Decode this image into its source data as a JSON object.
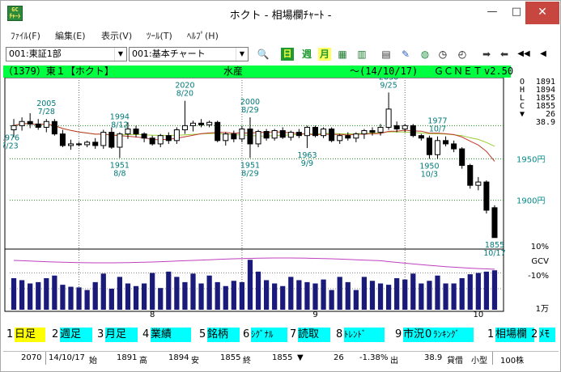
{
  "window": {
    "title": "ホクト - 相場欄ﾁｬｰﾄ -",
    "app_icon_text": "GC\nmaan",
    "min_glyph": "—",
    "max_glyph": "□",
    "close_glyph": "✕"
  },
  "menu": [
    {
      "label": "ﾌｧｲﾙ(F)"
    },
    {
      "label": "編集(E)"
    },
    {
      "label": "表示(V)"
    },
    {
      "label": "ﾂｰﾙ(T)"
    },
    {
      "label": "ﾍﾙﾌﾟ(H)"
    }
  ],
  "toolbar": {
    "market_select": "001:東証1部",
    "chart_select": "001:基本チャート",
    "day_label": "日",
    "week_label": "週",
    "month_label": "月"
  },
  "info": {
    "code": "（1379）東１【ホクト】",
    "sector": "水産",
    "date": "〜(14/10/17)",
    "brand": "ＧＣＮＥＴ",
    "version": "v2.50"
  },
  "ohlc": [
    {
      "key": "O",
      "value": "1891"
    },
    {
      "key": "H",
      "value": "1894"
    },
    {
      "key": "L",
      "value": "1855"
    },
    {
      "key": "C",
      "value": "1855"
    },
    {
      "key": "▼",
      "value": "26"
    },
    {
      "key": "",
      "value": "38.9"
    }
  ],
  "chart_data": {
    "type": "candlestick",
    "price_axis_labels": [
      "1950円",
      "1900円"
    ],
    "price_range": [
      1845,
      2045
    ],
    "volume_axis_labels": [
      "10%",
      "GCV",
      "-10%",
      "1万"
    ],
    "x_ticks": [
      "8",
      "9",
      "10"
    ],
    "annotations": [
      {
        "date": "7/28",
        "value": "2005"
      },
      {
        "date": "8/12",
        "value": "1994"
      },
      {
        "date": "8/20",
        "value": "2020"
      },
      {
        "date": "8/29",
        "value": "2000"
      },
      {
        "date": "9/25",
        "value": "2030"
      },
      {
        "date": "10/7",
        "value": "1977"
      },
      {
        "date": "7/23",
        "value": "1976"
      },
      {
        "date": "8/8",
        "value": "1951"
      },
      {
        "date": "8/29",
        "value": "1951"
      },
      {
        "date": "9/9",
        "value": "1963"
      },
      {
        "date": "10/3",
        "value": "1950"
      },
      {
        "date": "10/17",
        "value": "1855"
      }
    ],
    "candles": [
      {
        "o": 1985,
        "h": 1998,
        "l": 1976,
        "c": 1990
      },
      {
        "o": 1990,
        "h": 2000,
        "l": 1984,
        "c": 1995
      },
      {
        "o": 1995,
        "h": 2005,
        "l": 1987,
        "c": 1992
      },
      {
        "o": 1992,
        "h": 1998,
        "l": 1985,
        "c": 1988
      },
      {
        "o": 1988,
        "h": 1998,
        "l": 1982,
        "c": 1995
      },
      {
        "o": 1995,
        "h": 1998,
        "l": 1978,
        "c": 1980
      },
      {
        "o": 1980,
        "h": 1985,
        "l": 1964,
        "c": 1966
      },
      {
        "o": 1966,
        "h": 1973,
        "l": 1961,
        "c": 1968
      },
      {
        "o": 1968,
        "h": 1970,
        "l": 1965,
        "c": 1967
      },
      {
        "o": 1967,
        "h": 1972,
        "l": 1964,
        "c": 1970
      },
      {
        "o": 1970,
        "h": 1975,
        "l": 1962,
        "c": 1966
      },
      {
        "o": 1966,
        "h": 1985,
        "l": 1962,
        "c": 1982
      },
      {
        "o": 1982,
        "h": 1988,
        "l": 1962,
        "c": 1964
      },
      {
        "o": 1964,
        "h": 1982,
        "l": 1951,
        "c": 1980
      },
      {
        "o": 1980,
        "h": 1994,
        "l": 1974,
        "c": 1986
      },
      {
        "o": 1986,
        "h": 1990,
        "l": 1976,
        "c": 1980
      },
      {
        "o": 1980,
        "h": 1982,
        "l": 1970,
        "c": 1975
      },
      {
        "o": 1975,
        "h": 1978,
        "l": 1966,
        "c": 1968
      },
      {
        "o": 1968,
        "h": 1980,
        "l": 1964,
        "c": 1978
      },
      {
        "o": 1978,
        "h": 1982,
        "l": 1968,
        "c": 1972
      },
      {
        "o": 1972,
        "h": 1988,
        "l": 1968,
        "c": 1985
      },
      {
        "o": 1985,
        "h": 2020,
        "l": 1980,
        "c": 1990
      },
      {
        "o": 1990,
        "h": 1996,
        "l": 1983,
        "c": 1993
      },
      {
        "o": 1993,
        "h": 1998,
        "l": 1988,
        "c": 1991
      },
      {
        "o": 1991,
        "h": 1996,
        "l": 1988,
        "c": 1994
      },
      {
        "o": 1994,
        "h": 1996,
        "l": 1970,
        "c": 1972
      },
      {
        "o": 1972,
        "h": 1982,
        "l": 1966,
        "c": 1980
      },
      {
        "o": 1980,
        "h": 1984,
        "l": 1970,
        "c": 1974
      },
      {
        "o": 1974,
        "h": 1990,
        "l": 1970,
        "c": 1986
      },
      {
        "o": 1986,
        "h": 2000,
        "l": 1951,
        "c": 1968
      },
      {
        "o": 1968,
        "h": 1985,
        "l": 1964,
        "c": 1983
      },
      {
        "o": 1983,
        "h": 1986,
        "l": 1972,
        "c": 1975
      },
      {
        "o": 1975,
        "h": 1986,
        "l": 1972,
        "c": 1984
      },
      {
        "o": 1984,
        "h": 1988,
        "l": 1974,
        "c": 1976
      },
      {
        "o": 1976,
        "h": 1984,
        "l": 1972,
        "c": 1982
      },
      {
        "o": 1982,
        "h": 1986,
        "l": 1975,
        "c": 1978
      },
      {
        "o": 1978,
        "h": 1990,
        "l": 1963,
        "c": 1988
      },
      {
        "o": 1988,
        "h": 1990,
        "l": 1976,
        "c": 1978
      },
      {
        "o": 1978,
        "h": 1988,
        "l": 1975,
        "c": 1986
      },
      {
        "o": 1986,
        "h": 1988,
        "l": 1970,
        "c": 1972
      },
      {
        "o": 1972,
        "h": 1980,
        "l": 1968,
        "c": 1978
      },
      {
        "o": 1978,
        "h": 1982,
        "l": 1972,
        "c": 1975
      },
      {
        "o": 1975,
        "h": 1982,
        "l": 1970,
        "c": 1980
      },
      {
        "o": 1980,
        "h": 1986,
        "l": 1974,
        "c": 1984
      },
      {
        "o": 1984,
        "h": 1988,
        "l": 1978,
        "c": 1982
      },
      {
        "o": 1982,
        "h": 1992,
        "l": 1978,
        "c": 1988
      },
      {
        "o": 1988,
        "h": 2030,
        "l": 1985,
        "c": 2010
      },
      {
        "o": 1990,
        "h": 1995,
        "l": 1982,
        "c": 1986
      },
      {
        "o": 1986,
        "h": 1992,
        "l": 1982,
        "c": 1990
      },
      {
        "o": 1990,
        "h": 1992,
        "l": 1976,
        "c": 1978
      },
      {
        "o": 1978,
        "h": 1980,
        "l": 1972,
        "c": 1975
      },
      {
        "o": 1975,
        "h": 1978,
        "l": 1950,
        "c": 1955
      },
      {
        "o": 1955,
        "h": 1977,
        "l": 1950,
        "c": 1972
      },
      {
        "o": 1972,
        "h": 1977,
        "l": 1965,
        "c": 1968
      },
      {
        "o": 1968,
        "h": 1972,
        "l": 1958,
        "c": 1962
      },
      {
        "o": 1962,
        "h": 1964,
        "l": 1938,
        "c": 1942
      },
      {
        "o": 1942,
        "h": 1944,
        "l": 1914,
        "c": 1918
      },
      {
        "o": 1918,
        "h": 1928,
        "l": 1912,
        "c": 1922
      },
      {
        "o": 1922,
        "h": 1924,
        "l": 1884,
        "c": 1888
      },
      {
        "o": 1891,
        "h": 1894,
        "l": 1855,
        "c": 1855
      }
    ],
    "volume": [
      48,
      45,
      40,
      42,
      48,
      52,
      38,
      35,
      34,
      30,
      42,
      55,
      32,
      50,
      40,
      36,
      40,
      56,
      33,
      58,
      50,
      42,
      55,
      40,
      52,
      42,
      36,
      44,
      42,
      76,
      58,
      45,
      40,
      36,
      50,
      45,
      42,
      40,
      46,
      30,
      50,
      42,
      30,
      50,
      44,
      40,
      38,
      48,
      46,
      55,
      40,
      44,
      52,
      40,
      40,
      48,
      54,
      56,
      58,
      60
    ],
    "volume_range": [
      0,
      80
    ],
    "grid": true
  },
  "tabs": [
    {
      "num": "1",
      "label": "日足",
      "bg": "#ffff00"
    },
    {
      "num": "2",
      "label": "週足",
      "bg": "#00ffff"
    },
    {
      "num": "3",
      "label": "月足",
      "bg": "#00ffff"
    },
    {
      "num": "4",
      "label": "業績",
      "bg": "#00ffff"
    },
    {
      "num": "5",
      "label": "銘柄",
      "bg": "#00ffff"
    },
    {
      "num": "6",
      "label": "ｼｸﾞﾅﾙ",
      "bg": "#00ffff"
    },
    {
      "num": "7",
      "label": "読取",
      "bg": "#00ffff"
    },
    {
      "num": "8",
      "label": "ﾄﾚﾝﾄﾞ",
      "bg": "#00ffff"
    },
    {
      "num": "9",
      "label": "市況",
      "bg": "#00ffff"
    },
    {
      "num": "0",
      "label": "ﾗﾝｷﾝｸﾞ",
      "bg": "#00ffff"
    },
    {
      "num": "1",
      "label": "相場欄",
      "bg": "#00ffff"
    },
    {
      "num": "2",
      "label": "ﾒﾓ",
      "bg": "#00ffff"
    }
  ],
  "status": {
    "count": "2070",
    "date": "14/10/17",
    "open_label": "始",
    "open": "1891",
    "high_label": "高",
    "high": "1894",
    "low_label": "安",
    "low": "1855",
    "close_label": "終",
    "close": "1855",
    "arrow": "▼",
    "diff": "26",
    "pct": "-1.38%",
    "out_label": "出",
    "credit": "38.9",
    "credit_label": "貸借",
    "size_label": "小型",
    "unit": "100株"
  }
}
